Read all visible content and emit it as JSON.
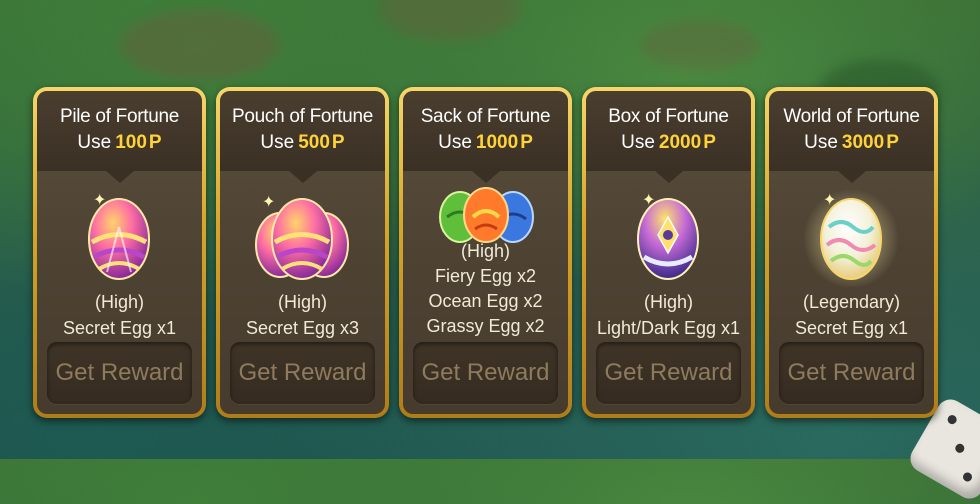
{
  "colors": {
    "gold_frame": "#d9a62a",
    "card_bg": "#4e4333",
    "cost_highlight": "#ffd23a",
    "button_text": "#8e7b5e",
    "reward_text": "#f1ead8"
  },
  "cards": [
    {
      "title": "Pile of Fortune",
      "cost_word": "Use",
      "cost_value": "100",
      "cost_unit": "P",
      "egg_icon": "secret-egg-icon",
      "reward_lines": [
        "(High)",
        "Secret Egg x1"
      ],
      "button_label": "Get Reward"
    },
    {
      "title": "Pouch of Fortune",
      "cost_word": "Use",
      "cost_value": "500",
      "cost_unit": "P",
      "egg_icon": "secret-egg-triple-icon",
      "reward_lines": [
        "(High)",
        "Secret Egg x3"
      ],
      "button_label": "Get Reward"
    },
    {
      "title": "Sack of Fortune",
      "cost_word": "Use",
      "cost_value": "1000",
      "cost_unit": "P",
      "egg_icon": "elemental-eggs-icon",
      "reward_lines": [
        "(High)",
        "Fiery Egg x2",
        "Ocean Egg x2",
        "Grassy Egg x2"
      ],
      "button_label": "Get Reward"
    },
    {
      "title": "Box of Fortune",
      "cost_word": "Use",
      "cost_value": "2000",
      "cost_unit": "P",
      "egg_icon": "light-dark-egg-icon",
      "reward_lines": [
        "(High)",
        "Light/Dark Egg x1"
      ],
      "button_label": "Get Reward"
    },
    {
      "title": "World of Fortune",
      "cost_word": "Use",
      "cost_value": "3000",
      "cost_unit": "P",
      "egg_icon": "legendary-secret-egg-icon",
      "reward_lines": [
        "(Legendary)",
        "Secret Egg x1"
      ],
      "button_label": "Get Reward"
    }
  ]
}
